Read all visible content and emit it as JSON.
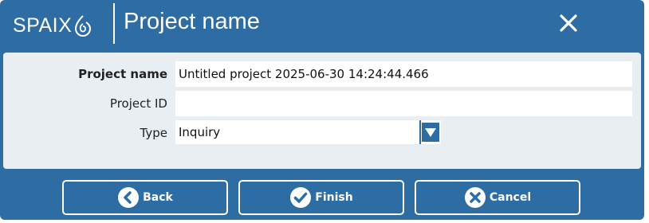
{
  "header": {
    "logo_text": "SPAIX",
    "title": "Project name",
    "close_icon": "close-icon"
  },
  "form": {
    "project_name": {
      "label": "Project name",
      "value": "Untitled project 2025-06-30 14:24:44.466"
    },
    "project_id": {
      "label": "Project ID",
      "value": ""
    },
    "type": {
      "label": "Type",
      "value": "Inquiry",
      "icon": "chevron-down-icon"
    }
  },
  "footer": {
    "back": {
      "label": "Back",
      "icon": "back-arrow-icon"
    },
    "finish": {
      "label": "Finish",
      "icon": "checkmark-icon"
    },
    "cancel": {
      "label": "Cancel",
      "icon": "close-circle-icon"
    }
  },
  "colors": {
    "primary": "#2e6da4",
    "content_bg": "#e9eef3",
    "text": "#222222"
  }
}
